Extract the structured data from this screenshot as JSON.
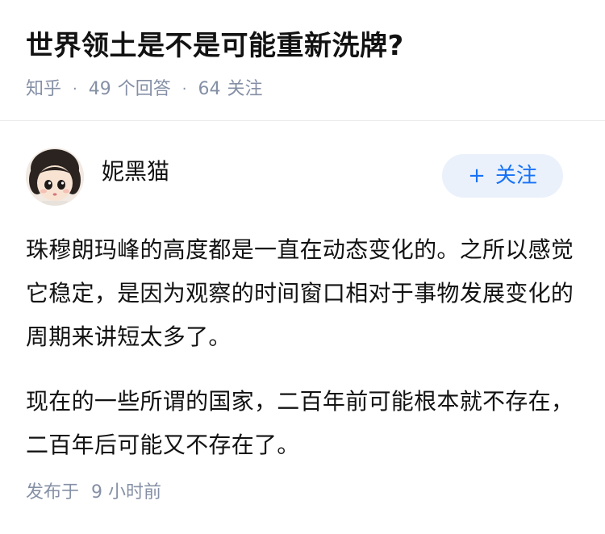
{
  "question": {
    "title": "世界领土是不是可能重新洗牌?",
    "source": "知乎",
    "answer_count": "49",
    "answer_label": "个回答",
    "follower_count": "64",
    "follower_label": "关注",
    "separator": "·"
  },
  "answer": {
    "author_name": "妮黑猫",
    "follow_button_label": "关注",
    "follow_button_icon": "plus-icon",
    "paragraphs": [
      "珠穆朗玛峰的高度都是一直在动态变化的。之所以感觉它稳定，是因为观察的时间窗口相对于事物发展变化的周期来讲短太多了。",
      "现在的一些所谓的国家，二百年前可能根本就不存在，二百年后可能又不存在了。"
    ],
    "publish_label": "发布于",
    "publish_time": "9 小时前"
  },
  "colors": {
    "text_primary": "#121212",
    "text_secondary": "#8590a6",
    "brand_blue": "#1772f6",
    "follow_bg": "#eaf1fb",
    "divider": "#ebebeb"
  }
}
